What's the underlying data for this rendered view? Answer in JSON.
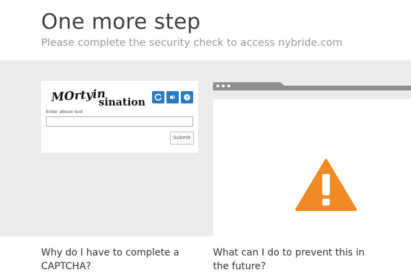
{
  "header": {
    "title": "One more step",
    "subtitle": "Please complete the security check to access nybride.com"
  },
  "captcha": {
    "image_words": [
      "MOrtyin",
      "sination"
    ],
    "buttons": [
      {
        "icon": "refresh-icon"
      },
      {
        "icon": "audio-icon"
      },
      {
        "icon": "help-icon"
      }
    ],
    "label": "Enter above text",
    "input_value": "",
    "submit_label": "Submit",
    "button_color": "#2a7bbf"
  },
  "browser_illustration": {
    "warning_color": "#f08a24"
  },
  "faq": {
    "q1": "Why do I have to complete a CAPTCHA?",
    "q2": "What can I do to prevent this in the future?"
  }
}
